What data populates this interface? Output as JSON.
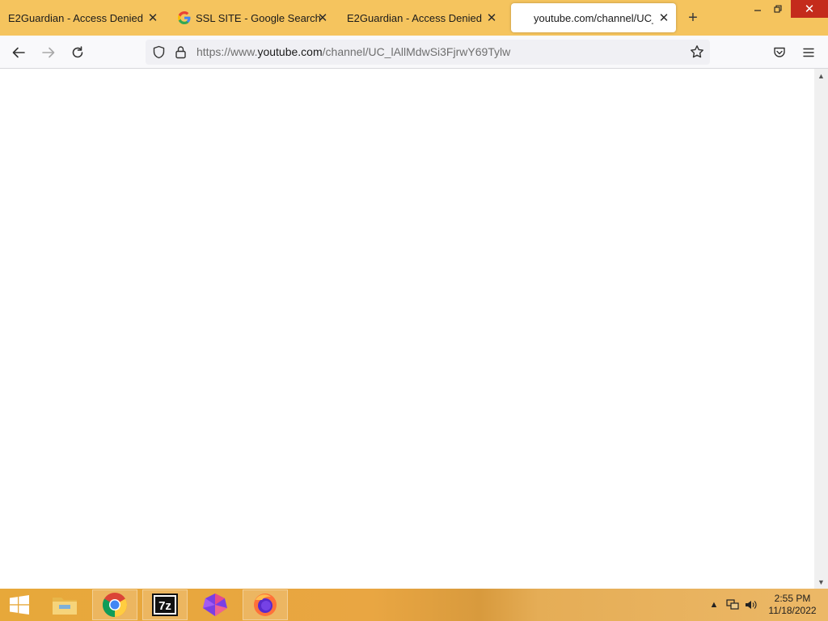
{
  "browser": {
    "tabs": [
      {
        "title": "E2Guardian - Access Denied",
        "active": false
      },
      {
        "title": "SSL SITE - Google Search",
        "active": false
      },
      {
        "title": "E2Guardian - Access Denied",
        "active": false
      },
      {
        "title": "youtube.com/channel/UC_lA",
        "active": true
      }
    ],
    "url": {
      "scheme": "https://www.",
      "host": "youtube.com",
      "path": "/channel/UC_lAllMdwSi3FjrwY69Tylw"
    }
  },
  "taskbar": {
    "apps": [
      "start-button",
      "file-explorer",
      "google-chrome",
      "7-zip",
      "gem-app",
      "firefox"
    ],
    "clock": {
      "time": "2:55 PM",
      "date": "11/18/2022"
    }
  },
  "colors": {
    "tabstrip": "#f5c45e",
    "taskbar": "#e7a83a",
    "window_close": "#c42b1c"
  }
}
